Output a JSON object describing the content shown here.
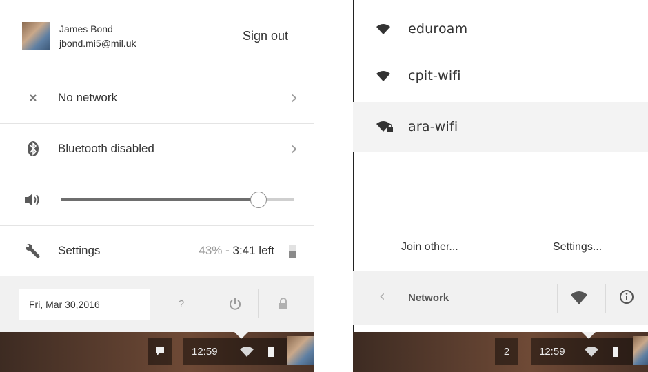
{
  "left_panel": {
    "user": {
      "name": "James Bond",
      "email": "jbond.mi5@mil.uk",
      "sign_out": "Sign out"
    },
    "items": [
      {
        "label": "No network",
        "icon": "no-network-icon",
        "has_chevron": true
      },
      {
        "label": "Bluetooth disabled",
        "icon": "bluetooth-icon",
        "has_chevron": true
      }
    ],
    "volume": {
      "icon": "speaker-icon",
      "level_fraction": 0.85
    },
    "settings": {
      "label": "Settings",
      "battery_percent": "43%",
      "battery_separator": " - ",
      "battery_time": "3:41 left"
    },
    "date": "Fri, Mar 30,2016",
    "bottom_icons": [
      "help-icon",
      "power-icon",
      "lock-icon"
    ],
    "shelf": {
      "time": "12:59"
    }
  },
  "right_panel": {
    "networks": [
      {
        "name": "eduroam",
        "secured": false,
        "highlighted": false
      },
      {
        "name": "cpit-wifi",
        "secured": false,
        "highlighted": false
      },
      {
        "name": "ara-wifi",
        "secured": true,
        "highlighted": true
      }
    ],
    "join_other": "Join other...",
    "settings": "Settings...",
    "back_label": "Network",
    "bottom_icons": [
      "wifi-icon",
      "info-icon"
    ],
    "shelf": {
      "notification_count": "2",
      "time": "12:59"
    }
  },
  "colors": {
    "bottom_bar": "#f1f1f1",
    "highlight_row": "#f3f3f3",
    "slider_fill": "#6e6e6e",
    "shelf": "#5a3d2e"
  }
}
